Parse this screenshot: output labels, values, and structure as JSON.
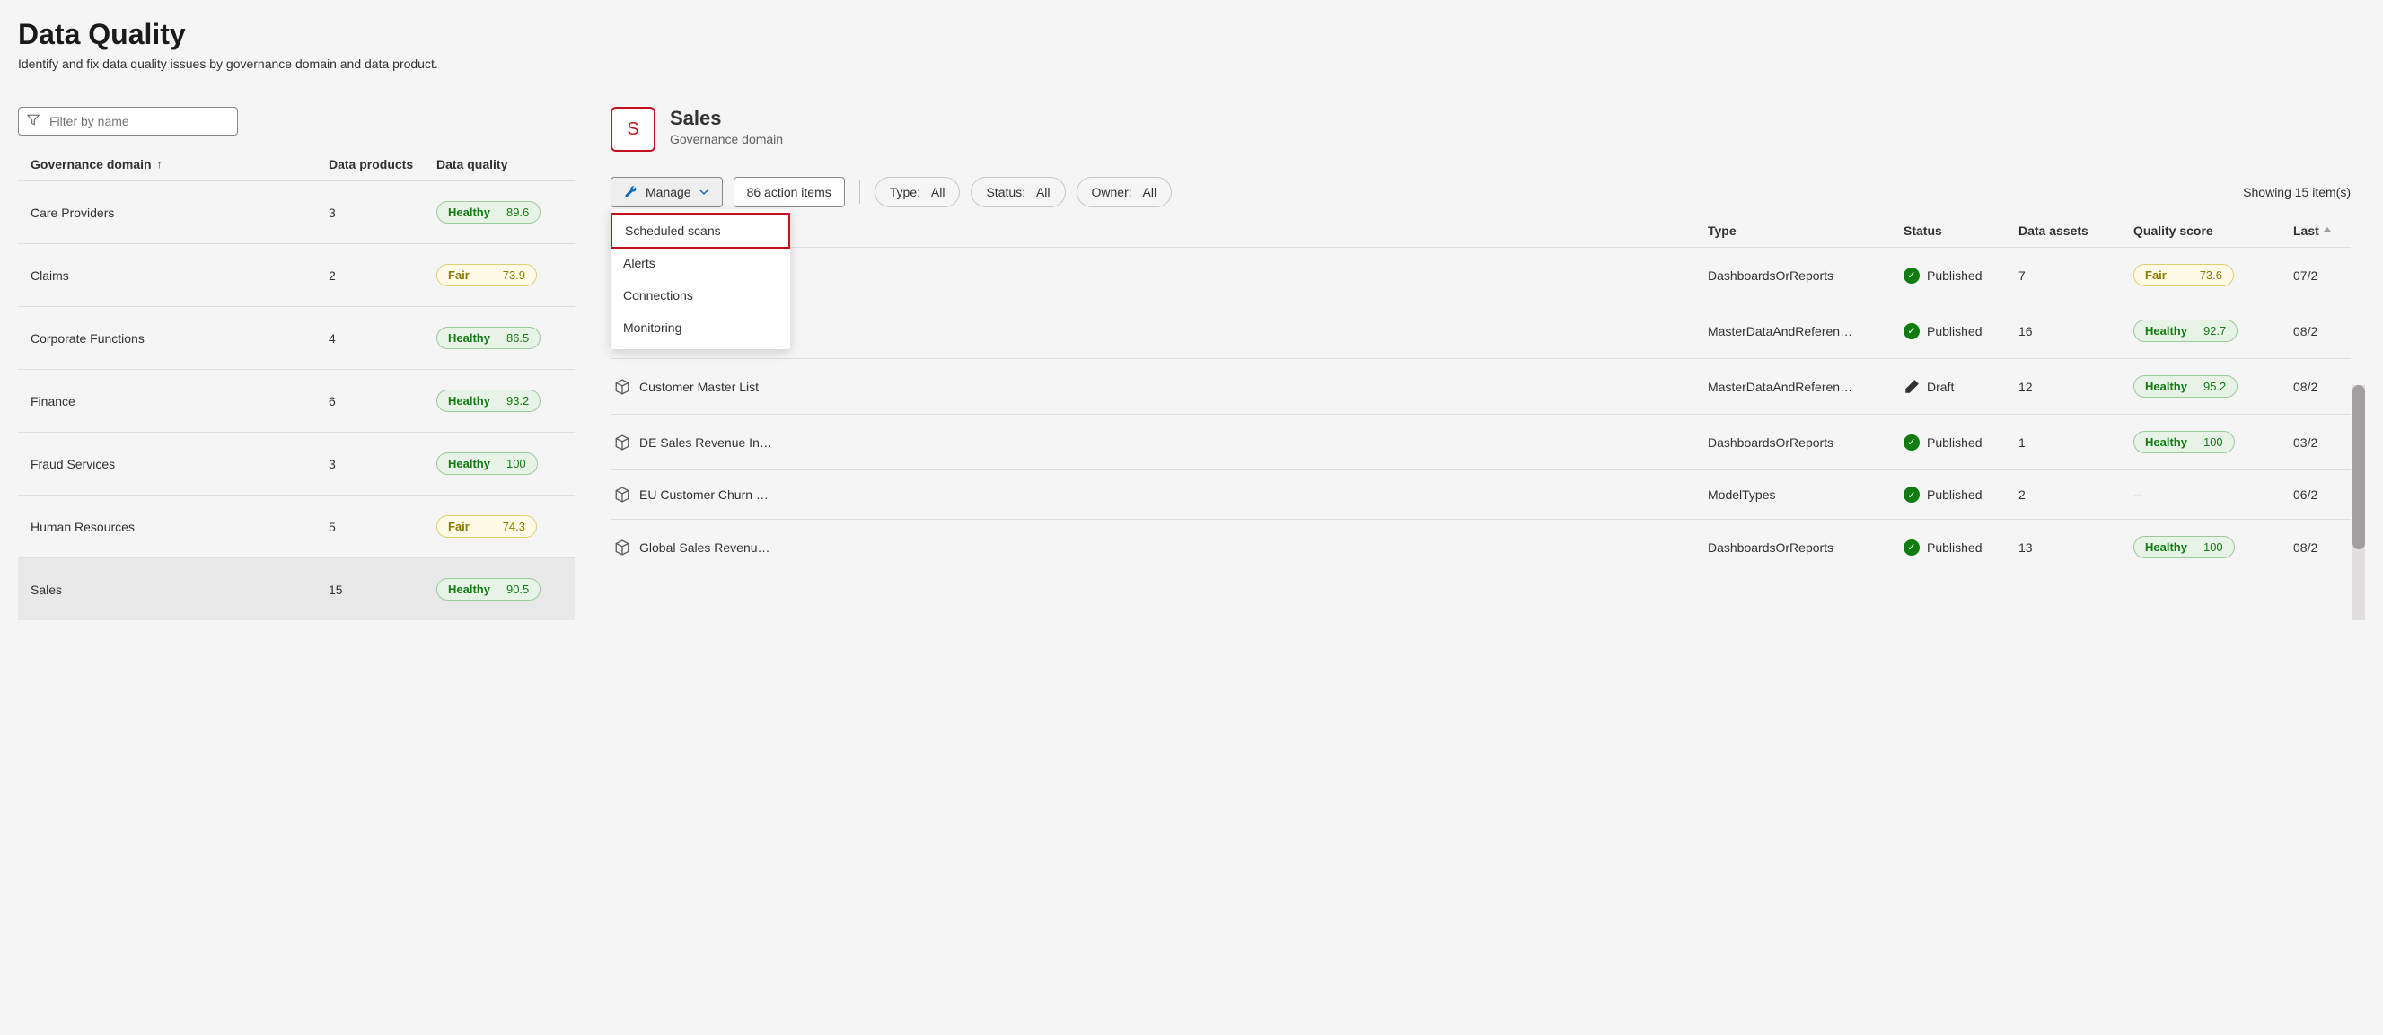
{
  "page": {
    "title": "Data Quality",
    "subtitle": "Identify and fix data quality issues by governance domain and data product."
  },
  "filter": {
    "placeholder": "Filter by name"
  },
  "domain_table": {
    "columns": {
      "domain": "Governance domain",
      "products": "Data products",
      "quality": "Data quality"
    },
    "rows": [
      {
        "name": "Care Providers",
        "products": "3",
        "quality_label": "Healthy",
        "quality_value": "89.6",
        "quality_class": "healthy",
        "selected": false
      },
      {
        "name": "Claims",
        "products": "2",
        "quality_label": "Fair",
        "quality_value": "73.9",
        "quality_class": "fair",
        "selected": false
      },
      {
        "name": "Corporate Functions",
        "products": "4",
        "quality_label": "Healthy",
        "quality_value": "86.5",
        "quality_class": "healthy",
        "selected": false
      },
      {
        "name": "Finance",
        "products": "6",
        "quality_label": "Healthy",
        "quality_value": "93.2",
        "quality_class": "healthy",
        "selected": false
      },
      {
        "name": "Fraud Services",
        "products": "3",
        "quality_label": "Healthy",
        "quality_value": "100",
        "quality_class": "healthy",
        "selected": false
      },
      {
        "name": "Human Resources",
        "products": "5",
        "quality_label": "Fair",
        "quality_value": "74.3",
        "quality_class": "fair",
        "selected": false
      },
      {
        "name": "Sales",
        "products": "15",
        "quality_label": "Healthy",
        "quality_value": "90.5",
        "quality_class": "healthy",
        "selected": true
      }
    ]
  },
  "detail": {
    "avatar_letter": "S",
    "title": "Sales",
    "subtitle": "Governance domain"
  },
  "toolbar": {
    "manage_label": "Manage",
    "action_items_label": "86 action items",
    "type_label": "Type:",
    "type_value": "All",
    "status_label": "Status:",
    "status_value": "All",
    "owner_label": "Owner:",
    "owner_value": "All",
    "showing": "Showing 15 item(s)"
  },
  "manage_menu": {
    "items": [
      {
        "label": "Scheduled scans",
        "highlighted": true
      },
      {
        "label": "Alerts",
        "highlighted": false
      },
      {
        "label": "Connections",
        "highlighted": false
      },
      {
        "label": "Monitoring",
        "highlighted": false
      }
    ]
  },
  "product_table": {
    "columns": {
      "name": "",
      "type": "Type",
      "status": "Status",
      "assets": "Data assets",
      "score": "Quality score",
      "last": "Last"
    },
    "rows": [
      {
        "name": "",
        "type": "DashboardsOrReports",
        "status": "Published",
        "status_kind": "published",
        "assets": "7",
        "score_label": "Fair",
        "score_value": "73.6",
        "score_class": "fair",
        "last": "07/2",
        "has_icon": false
      },
      {
        "name": "",
        "type": "MasterDataAndReferen…",
        "status": "Published",
        "status_kind": "published",
        "assets": "16",
        "score_label": "Healthy",
        "score_value": "92.7",
        "score_class": "healthy",
        "last": "08/2",
        "has_icon": false
      },
      {
        "name": "Customer Master List",
        "type": "MasterDataAndReferen…",
        "status": "Draft",
        "status_kind": "draft",
        "assets": "12",
        "score_label": "Healthy",
        "score_value": "95.2",
        "score_class": "healthy",
        "last": "08/2",
        "has_icon": true
      },
      {
        "name": "DE Sales Revenue In…",
        "type": "DashboardsOrReports",
        "status": "Published",
        "status_kind": "published",
        "assets": "1",
        "score_label": "Healthy",
        "score_value": "100",
        "score_class": "healthy",
        "last": "03/2",
        "has_icon": true
      },
      {
        "name": "EU Customer Churn …",
        "type": "ModelTypes",
        "status": "Published",
        "status_kind": "published",
        "assets": "2",
        "score_label": "--",
        "score_value": "",
        "score_class": "plain",
        "last": "06/2",
        "has_icon": true
      },
      {
        "name": "Global Sales Revenu…",
        "type": "DashboardsOrReports",
        "status": "Published",
        "status_kind": "published",
        "assets": "13",
        "score_label": "Healthy",
        "score_value": "100",
        "score_class": "healthy",
        "last": "08/2",
        "has_icon": true
      }
    ]
  }
}
